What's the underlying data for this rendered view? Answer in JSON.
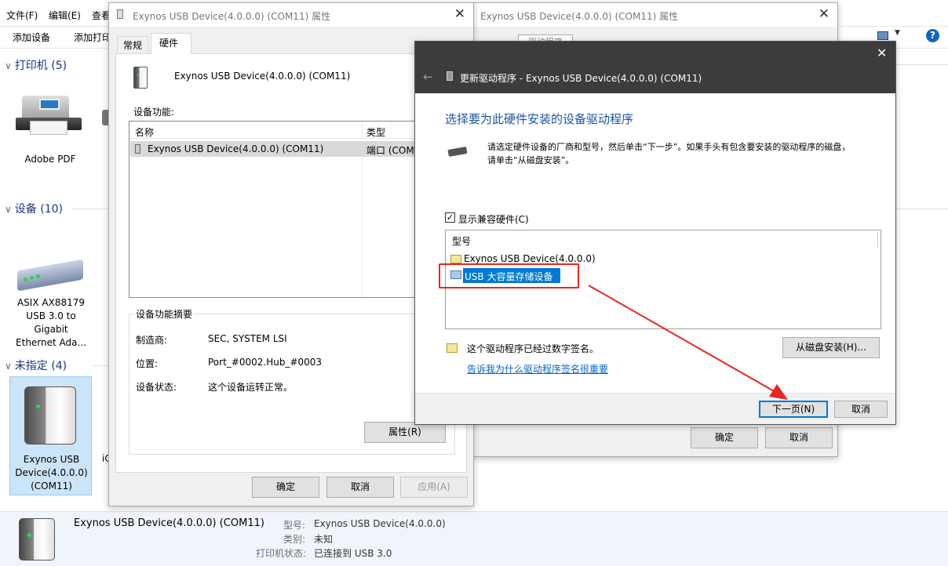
{
  "explorer": {
    "menu": [
      "文件(F)",
      "编辑(E)",
      "查看"
    ],
    "toolbar": [
      "添加设备",
      "添加打印"
    ],
    "sections": {
      "printers": "打印机 (5)",
      "devices": "设备 (10)",
      "unspecified": "未指定 (4)"
    },
    "devices": {
      "adobe": "Adobe PDF",
      "asix_lines": [
        "ASIX AX88179",
        "USB 3.0 to",
        "Gigabit",
        "Ethernet Ada..."
      ],
      "exynos_lines": [
        "Exynos USB",
        "Device(4.0.0.0)",
        "(COM11)"
      ],
      "partial_label": "iC"
    },
    "status": {
      "device_name": "Exynos USB Device(4.0.0.0) (COM11)",
      "model_label": "型号:",
      "model_value": "Exynos USB Device(4.0.0.0)",
      "category_label": "类别:",
      "category_value": "未知",
      "printer_label": "打印机状态:",
      "printer_value": "已连接到 USB 3.0"
    }
  },
  "props": {
    "title": "Exynos USB Device(4.0.0.0) (COM11) 属性",
    "tabs": [
      "常规",
      "硬件"
    ],
    "device_name": "Exynos USB Device(4.0.0.0) (COM11)",
    "functions_label": "设备功能:",
    "columns": [
      "名称",
      "类型"
    ],
    "rows": [
      {
        "name": "Exynos USB Device(4.0.0.0) (COM11)",
        "type": "端口 (COM"
      }
    ],
    "summary_title": "设备功能摘要",
    "summary": [
      {
        "label": "制造商:",
        "value": "SEC, SYSTEM LSI"
      },
      {
        "label": "位置:",
        "value": "Port_#0002.Hub_#0003"
      },
      {
        "label": "设备状态:",
        "value": "这个设备运转正常。"
      }
    ],
    "properties_button": "属性(R)",
    "ok": "确定",
    "cancel": "取消",
    "apply": "应用(A)"
  },
  "props2": {
    "title": "Exynos USB Device(4.0.0.0) (COM11) 属性",
    "tab_partial": "驱动程序",
    "ok": "确定",
    "cancel": "取消"
  },
  "wizard": {
    "title": "更新驱动程序 - Exynos USB Device(4.0.0.0) (COM11)",
    "heading": "选择要为此硬件安装的设备驱动程序",
    "description_line1": "请选定硬件设备的厂商和型号，然后单击“下一步”。如果手头有包含要安装的驱动程序的磁盘，",
    "description_line2": "请单击“从磁盘安装”。",
    "show_compatible": "显示兼容硬件(C)",
    "show_compatible_checked": true,
    "model_header": "型号",
    "models": [
      "Exynos USB Device(4.0.0.0)",
      "USB 大容量存储设备"
    ],
    "selected_index": 1,
    "signed_text": "这个驱动程序已经过数字签名。",
    "signing_link": "告诉我为什么驱动程序签名很重要",
    "from_disk": "从磁盘安装(H)...",
    "next": "下一页(N)",
    "cancel": "取消"
  },
  "colors": {
    "wizard_titlebar": "#3c3c3c",
    "heading_blue": "#1a54a8",
    "selection": "#0078d7",
    "annotation_red": "#e8271f"
  }
}
